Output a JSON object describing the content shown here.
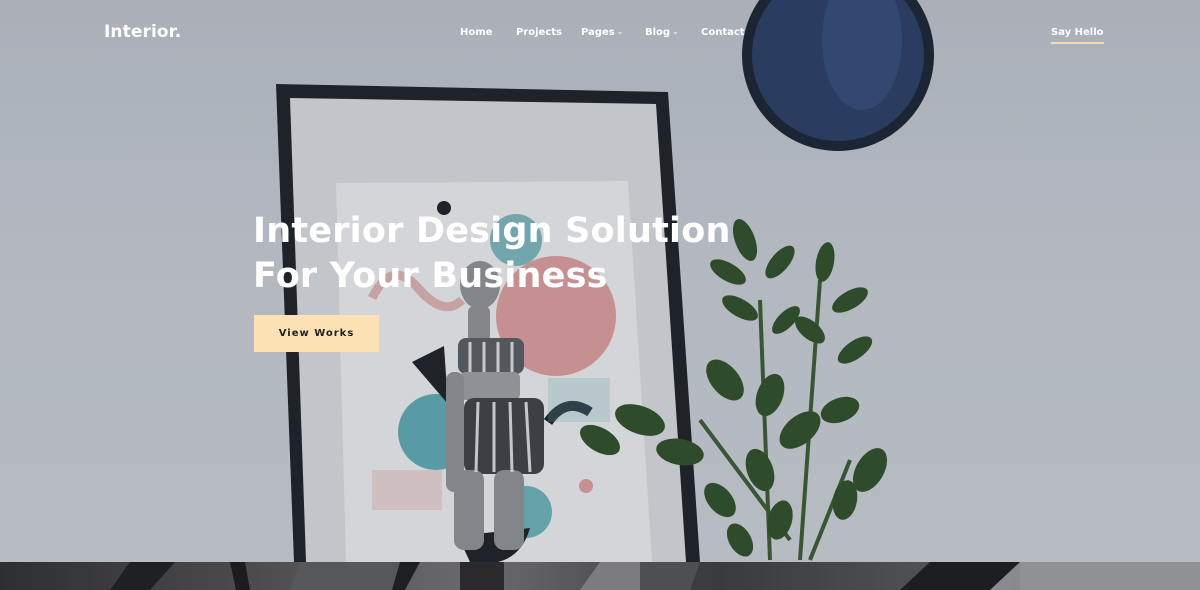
{
  "brand": {
    "logo": "Interior."
  },
  "nav": {
    "items": [
      {
        "label": "Home",
        "has_dropdown": false
      },
      {
        "label": "Projects",
        "has_dropdown": false
      },
      {
        "label": "Pages",
        "has_dropdown": true
      },
      {
        "label": "Blog",
        "has_dropdown": true
      },
      {
        "label": "Contact",
        "has_dropdown": false
      }
    ],
    "caret": "⌄",
    "cta": "Say Hello"
  },
  "hero": {
    "title_line1": "Interior Design Solution",
    "title_line2": "For Your Business",
    "button_label": "View Works"
  },
  "colors": {
    "accent": "#fce1b5",
    "underline": "#f5dcb0",
    "text": "#ffffff"
  }
}
